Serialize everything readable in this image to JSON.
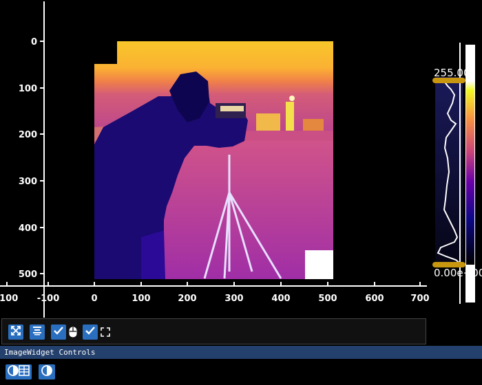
{
  "plot": {
    "x_ticks": [
      "-100",
      "-100",
      "0",
      "100",
      "200",
      "300",
      "400",
      "500",
      "600",
      "700"
    ],
    "y_ticks": [
      "0",
      "100",
      "200",
      "300",
      "400",
      "500"
    ],
    "image_extent": {
      "x": [
        0,
        512
      ],
      "y": [
        0,
        512
      ]
    },
    "colormap": "plasma"
  },
  "histogram": {
    "max_label": "255.00",
    "min_label": "0.00e+00",
    "handle_color": "#c8960f"
  },
  "toolbar": {
    "buttons": [
      {
        "name": "auto-range-button",
        "icon": "expand-arrows-icon",
        "checked": false
      },
      {
        "name": "align-center-button",
        "icon": "align-center-icon",
        "checked": false
      },
      {
        "name": "mouse-mode-checkbox",
        "icon": "mouse-icon",
        "checked": true
      },
      {
        "name": "roi-checkbox",
        "icon": "fullscreen-frame-icon",
        "checked": true
      }
    ]
  },
  "controls": {
    "header": "ImageWidget Controls",
    "buttons": [
      {
        "name": "colormap-button",
        "icon": "colormap-toggle-icon"
      },
      {
        "name": "invert-contrast-button",
        "icon": "contrast-icon"
      }
    ]
  },
  "colors": {
    "accent": "#2a6fbf",
    "header_bg": "#24406c",
    "background": "#000000"
  }
}
